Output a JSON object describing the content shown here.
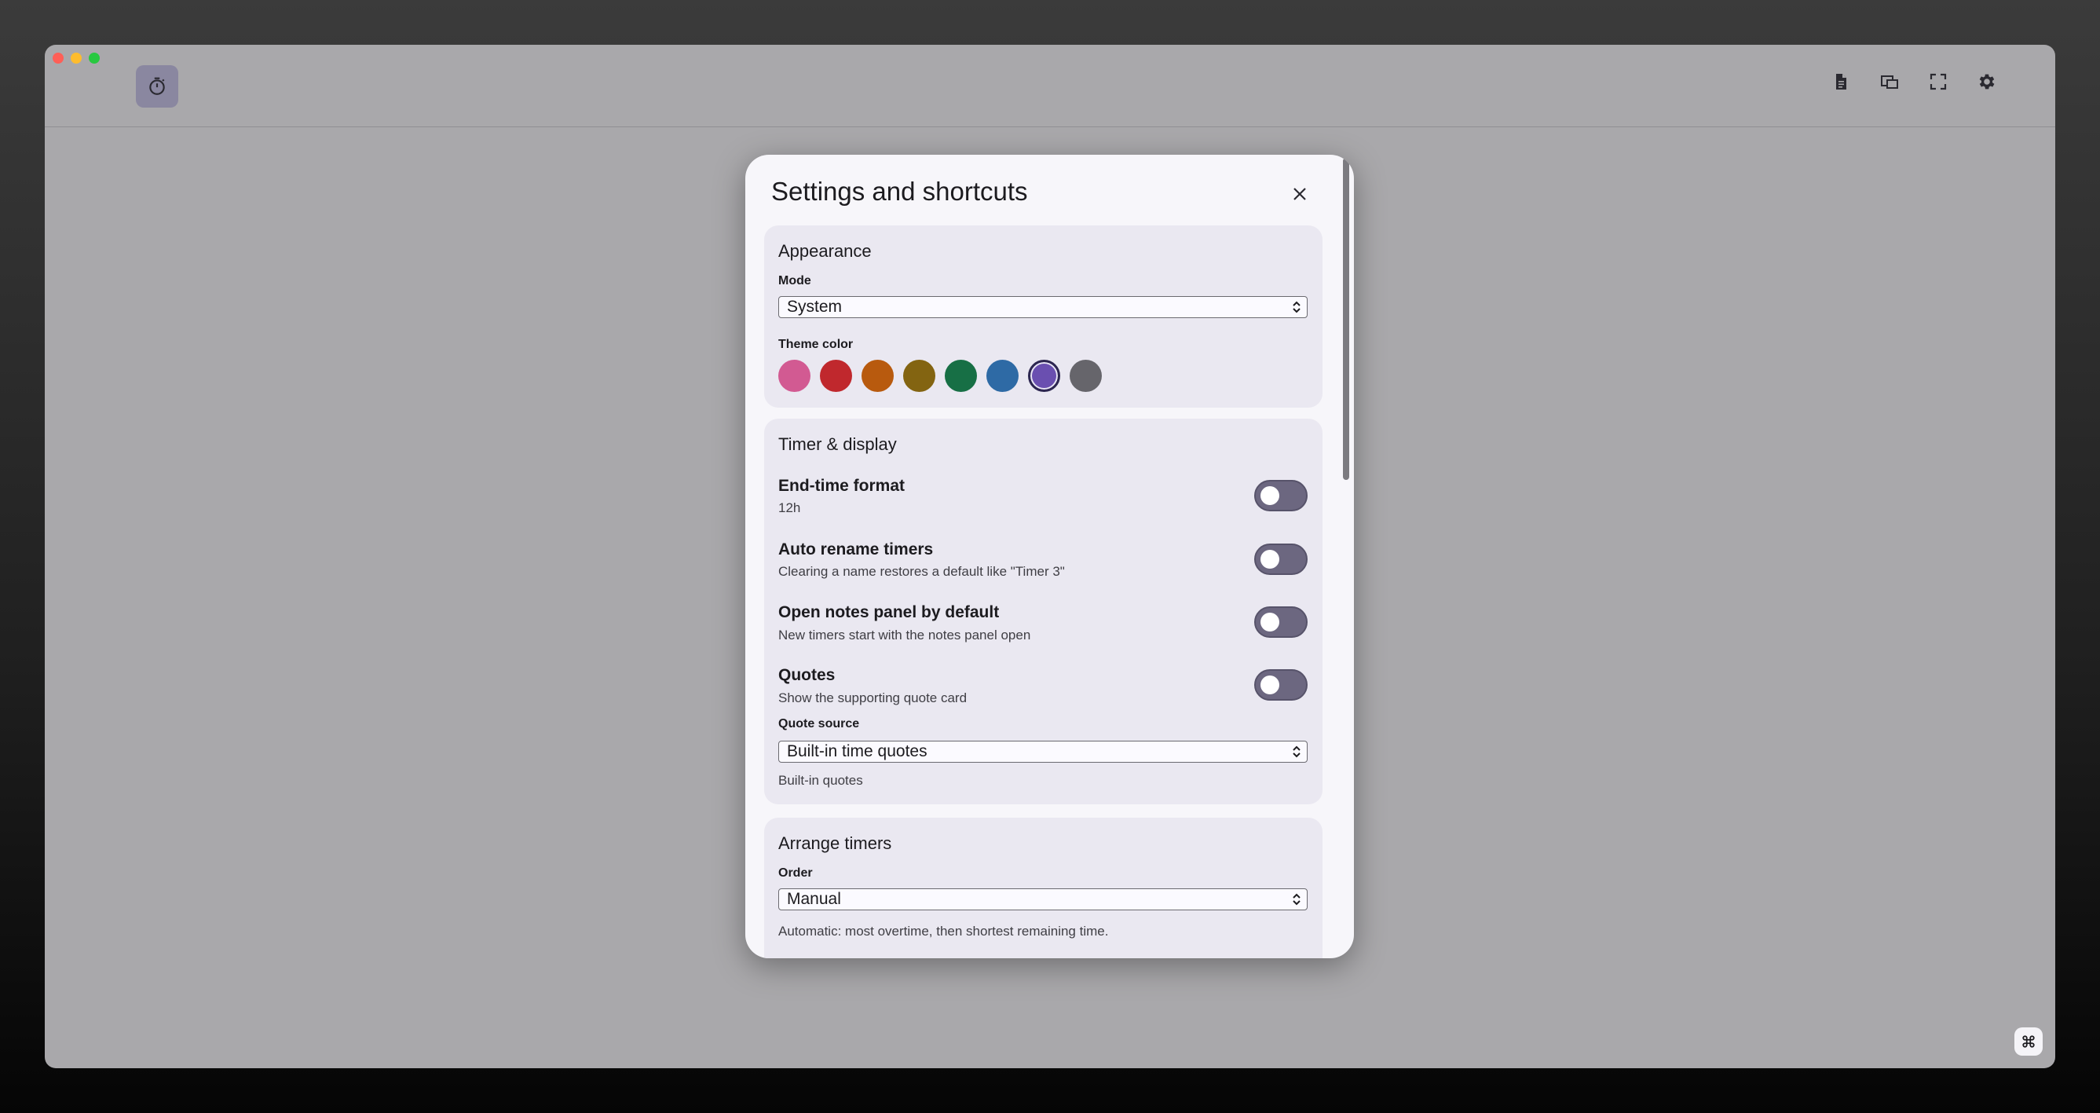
{
  "window": {
    "toolbar_icons": [
      "timer-icon",
      "document-icon",
      "copy-window-icon",
      "fullscreen-icon",
      "gear-icon"
    ],
    "corner_icon": "command-icon"
  },
  "modal": {
    "title": "Settings and shortcuts",
    "close_icon": "close-icon",
    "appearance": {
      "title": "Appearance",
      "mode_label": "Mode",
      "mode_value": "System",
      "theme_label": "Theme color",
      "theme_colors": [
        "#d25a92",
        "#c0282d",
        "#b85a0e",
        "#836411",
        "#176f45",
        "#2e6aa5",
        "#6a4fb0",
        "#66656b"
      ],
      "selected_theme_color": "#6a4fb0"
    },
    "timer": {
      "title": "Timer & display",
      "rows": [
        {
          "title": "End-time format",
          "subtitle": "12h",
          "enabled": false
        },
        {
          "title": "Auto rename timers",
          "subtitle": "Clearing a name restores a default like \"Timer 3\"",
          "enabled": false
        },
        {
          "title": "Open notes panel by default",
          "subtitle": "New timers start with the notes panel open",
          "enabled": false
        },
        {
          "title": "Quotes",
          "subtitle": "Show the supporting quote card",
          "enabled": false
        }
      ],
      "quote_source_label": "Quote source",
      "quote_source_value": "Built-in time quotes",
      "quote_source_helper": "Built-in quotes"
    },
    "arrange": {
      "title": "Arrange timers",
      "order_label": "Order",
      "order_value": "Manual",
      "order_helper": "Automatic: most overtime, then shortest remaining time."
    }
  }
}
